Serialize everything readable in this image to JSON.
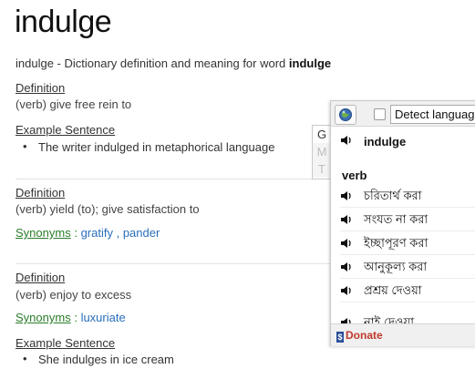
{
  "word": "indulge",
  "subtitle": {
    "prefix": "indulge - Dictionary definition and meaning for word",
    "word": "indulge"
  },
  "definitions": [
    {
      "label": "Definition",
      "text": "(verb) give free rein to",
      "example_label": "Example Sentence",
      "examples": [
        "The writer indulged in metaphorical language"
      ]
    },
    {
      "label": "Definition",
      "text": "(verb) yield (to); give satisfaction to",
      "synonyms_label": "Synonyms",
      "synonyms": [
        "gratify",
        "pander"
      ]
    },
    {
      "label": "Definition",
      "text": "(verb) enjoy to excess",
      "synonyms_label": "Synonyms",
      "synonyms": [
        "luxuriate"
      ],
      "example_label": "Example Sentence",
      "examples": [
        "She indulges in ice cream"
      ]
    }
  ],
  "popup": {
    "detect_label": "Detect language",
    "gmt": [
      "G",
      "M",
      "T"
    ],
    "headword": "indulge",
    "part_of_speech": "verb",
    "translations": [
      "চরিতার্থ করা",
      "সংযত না করা",
      "ইচ্ছাপূরণ করা",
      "আনুকূল্য করা",
      "প্রশ্রয় দেওয়া",
      "নাই দেওয়া"
    ],
    "donate_label": "Donate",
    "donate_icon": "$"
  },
  "colors": {
    "synonym_label": "#2a7d2a",
    "synonym_link": "#2a6ebb",
    "donate": "#c0392b"
  }
}
